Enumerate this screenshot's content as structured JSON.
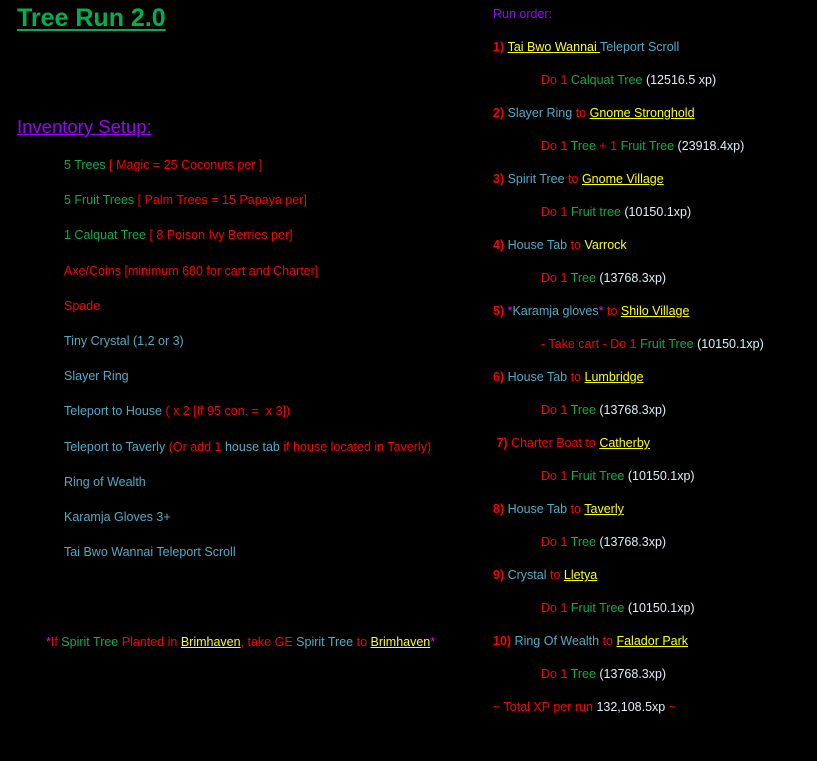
{
  "colors": {
    "green": "#00b050",
    "red": "#ff0000",
    "blue": "#4bacc6",
    "yellow": "#ffff00",
    "purple": "#9b00ff",
    "magenta": "#ff00ff",
    "white": "#dbeef3"
  },
  "title": "Tree Run 2.0",
  "inventory_heading": "Inventory Setup:",
  "inventory": [
    [
      {
        "t": "5 Trees ",
        "c": "green"
      },
      {
        "t": "[ Magic = 25 Coconuts per ]",
        "c": "red"
      }
    ],
    [
      {
        "t": "5 Fruit Trees ",
        "c": "green"
      },
      {
        "t": "[ Palm Trees = 15 Papaya per]",
        "c": "red"
      }
    ],
    [
      {
        "t": "1 Calquat Tree ",
        "c": "green"
      },
      {
        "t": "[ 8 Poison Ivy Berries per]",
        "c": "red"
      }
    ],
    [
      {
        "t": "Axe/Coins [minimum 680 for cart and Charter]",
        "c": "red"
      }
    ],
    [
      {
        "t": "Spade",
        "c": "red"
      }
    ],
    [
      {
        "t": "Tiny Crystal (1,2 or 3)",
        "c": "blue"
      }
    ],
    [
      {
        "t": "Slayer Ring",
        "c": "blue"
      }
    ],
    [
      {
        "t": "Teleport to House ",
        "c": "blue"
      },
      {
        "t": "( x 2 [If 95 con. =  x 3])",
        "c": "red"
      }
    ],
    [
      {
        "t": "Teleport to Taverly ",
        "c": "blue"
      },
      {
        "t": "(Or add 1 ",
        "c": "red"
      },
      {
        "t": "house tab ",
        "c": "blue"
      },
      {
        "t": "if house located in Taverly)",
        "c": "red"
      }
    ],
    [
      {
        "t": "Ring of Wealth",
        "c": "blue"
      }
    ],
    [
      {
        "t": "Karamja Gloves 3+",
        "c": "blue"
      }
    ],
    [
      {
        "t": "Tai Bwo Wannai Teleport Scroll",
        "c": "blue"
      }
    ]
  ],
  "footnote": [
    {
      "t": "*",
      "c": "magenta"
    },
    {
      "t": "If ",
      "c": "red"
    },
    {
      "t": "Spirit Tree ",
      "c": "green"
    },
    {
      "t": "Planted in ",
      "c": "red"
    },
    {
      "t": "Brimhaven",
      "c": "yellow",
      "u": true
    },
    {
      "t": ", take GE ",
      "c": "red"
    },
    {
      "t": "Spirit Tree ",
      "c": "blue"
    },
    {
      "t": "to ",
      "c": "red"
    },
    {
      "t": "Brimhaven",
      "c": "yellow",
      "u": true
    },
    {
      "t": "*",
      "c": "magenta"
    }
  ],
  "run_order": [
    {
      "kind": "hdr",
      "segs": [
        {
          "t": "Run order:",
          "c": "purple"
        }
      ]
    },
    {
      "kind": "step",
      "segs": [
        {
          "t": "1) ",
          "c": "red",
          "b": true
        },
        {
          "t": "Tai Bwo Wannai ",
          "c": "yellow",
          "u": true
        },
        {
          "t": "Teleport Scroll",
          "c": "blue"
        }
      ]
    },
    {
      "kind": "sub",
      "segs": [
        {
          "t": "Do 1 ",
          "c": "red"
        },
        {
          "t": "Calquat Tree ",
          "c": "green"
        },
        {
          "t": "(12516.5 xp)",
          "c": "white"
        }
      ]
    },
    {
      "kind": "step",
      "segs": [
        {
          "t": "2) ",
          "c": "red",
          "b": true
        },
        {
          "t": "Slayer Ring ",
          "c": "blue"
        },
        {
          "t": "to ",
          "c": "red"
        },
        {
          "t": "Gnome Stronghold",
          "c": "yellow",
          "u": true
        }
      ]
    },
    {
      "kind": "sub",
      "segs": [
        {
          "t": "Do 1 ",
          "c": "red"
        },
        {
          "t": "Tree ",
          "c": "green"
        },
        {
          "t": "+ 1 ",
          "c": "red"
        },
        {
          "t": "Fruit Tree ",
          "c": "green"
        },
        {
          "t": "(23918.4xp)",
          "c": "white"
        }
      ]
    },
    {
      "kind": "step",
      "segs": [
        {
          "t": "3) ",
          "c": "red",
          "b": true
        },
        {
          "t": "Spirit Tree ",
          "c": "blue"
        },
        {
          "t": "to ",
          "c": "red"
        },
        {
          "t": "Gnome Village",
          "c": "yellow",
          "u": true
        }
      ]
    },
    {
      "kind": "sub",
      "segs": [
        {
          "t": "Do 1 ",
          "c": "red"
        },
        {
          "t": "Fruit tree ",
          "c": "green"
        },
        {
          "t": "(10150.1xp)",
          "c": "white"
        }
      ]
    },
    {
      "kind": "step",
      "segs": [
        {
          "t": "4) ",
          "c": "red",
          "b": true
        },
        {
          "t": "House Tab ",
          "c": "blue"
        },
        {
          "t": "to ",
          "c": "red"
        },
        {
          "t": "Varrock",
          "c": "yellow"
        }
      ]
    },
    {
      "kind": "sub",
      "segs": [
        {
          "t": "Do 1 ",
          "c": "red"
        },
        {
          "t": "Tree ",
          "c": "green"
        },
        {
          "t": "(13768.3xp)",
          "c": "white"
        }
      ]
    },
    {
      "kind": "step",
      "segs": [
        {
          "t": "5) ",
          "c": "red",
          "b": true
        },
        {
          "t": "*",
          "c": "magenta"
        },
        {
          "t": "Karamja gloves",
          "c": "blue"
        },
        {
          "t": "*",
          "c": "magenta"
        },
        {
          "t": " to ",
          "c": "red"
        },
        {
          "t": "Shilo Village",
          "c": "yellow",
          "u": true
        }
      ]
    },
    {
      "kind": "sub",
      "segs": [
        {
          "t": "- Take cart - Do 1 ",
          "c": "red"
        },
        {
          "t": "Fruit Tree ",
          "c": "green"
        },
        {
          "t": "(10150.1xp)",
          "c": "white"
        }
      ]
    },
    {
      "kind": "step",
      "segs": [
        {
          "t": "6) ",
          "c": "red",
          "b": true
        },
        {
          "t": "House Tab ",
          "c": "blue"
        },
        {
          "t": "to ",
          "c": "red"
        },
        {
          "t": "Lumbridge",
          "c": "yellow",
          "u": true
        }
      ]
    },
    {
      "kind": "sub",
      "segs": [
        {
          "t": "Do 1 ",
          "c": "red"
        },
        {
          "t": "Tree ",
          "c": "green"
        },
        {
          "t": "(13768.3xp)",
          "c": "white"
        }
      ]
    },
    {
      "kind": "step",
      "segs": [
        {
          "t": " 7) ",
          "c": "red",
          "b": true
        },
        {
          "t": "Charter Boat to ",
          "c": "red"
        },
        {
          "t": "Catherby",
          "c": "yellow",
          "u": true
        }
      ]
    },
    {
      "kind": "sub",
      "segs": [
        {
          "t": "Do 1 ",
          "c": "red"
        },
        {
          "t": "Fruit Tree ",
          "c": "green"
        },
        {
          "t": "(10150.1xp)",
          "c": "white"
        }
      ]
    },
    {
      "kind": "step",
      "segs": [
        {
          "t": "8) ",
          "c": "red",
          "b": true
        },
        {
          "t": "House Tab ",
          "c": "blue"
        },
        {
          "t": "to ",
          "c": "red"
        },
        {
          "t": "Taverly",
          "c": "yellow",
          "u": true
        }
      ]
    },
    {
      "kind": "sub",
      "segs": [
        {
          "t": "Do 1 ",
          "c": "red"
        },
        {
          "t": "Tree ",
          "c": "green"
        },
        {
          "t": "(13768.3xp)",
          "c": "white"
        }
      ]
    },
    {
      "kind": "step",
      "segs": [
        {
          "t": "9) ",
          "c": "red",
          "b": true
        },
        {
          "t": "Crystal ",
          "c": "blue"
        },
        {
          "t": "to ",
          "c": "red"
        },
        {
          "t": "Lletya",
          "c": "yellow",
          "u": true
        }
      ]
    },
    {
      "kind": "sub",
      "segs": [
        {
          "t": "Do 1 ",
          "c": "red"
        },
        {
          "t": "Fruit Tree ",
          "c": "green"
        },
        {
          "t": "(10150.1xp)",
          "c": "white"
        }
      ]
    },
    {
      "kind": "step",
      "segs": [
        {
          "t": "10) ",
          "c": "red",
          "b": true
        },
        {
          "t": "Ring Of Wealth ",
          "c": "blue"
        },
        {
          "t": "to ",
          "c": "red"
        },
        {
          "t": "Falador Park",
          "c": "yellow",
          "u": true
        }
      ]
    },
    {
      "kind": "sub",
      "segs": [
        {
          "t": "Do 1 ",
          "c": "red"
        },
        {
          "t": "Tree ",
          "c": "green"
        },
        {
          "t": "(13768.3xp)",
          "c": "white"
        }
      ]
    },
    {
      "kind": "total",
      "segs": [
        {
          "t": "~ Total XP per run ",
          "c": "red"
        },
        {
          "t": "132,108.5xp",
          "c": "white"
        },
        {
          "t": " ~",
          "c": "red"
        }
      ]
    }
  ]
}
